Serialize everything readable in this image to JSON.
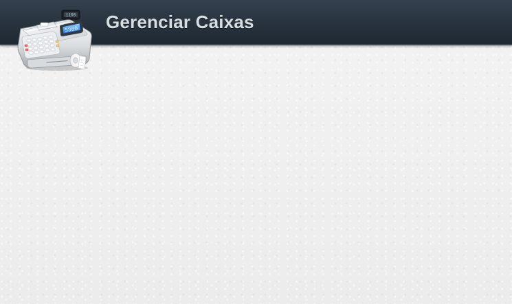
{
  "header": {
    "title": "Gerenciar Caixas",
    "logo": {
      "icon": "cash-register-icon",
      "display_value": "5380"
    }
  },
  "colors": {
    "header_dark": "#27323d",
    "header_light": "#34414f",
    "title_text": "#d8dde2",
    "page_background": "#eeeeee",
    "display_blue": "#2f74d8"
  }
}
